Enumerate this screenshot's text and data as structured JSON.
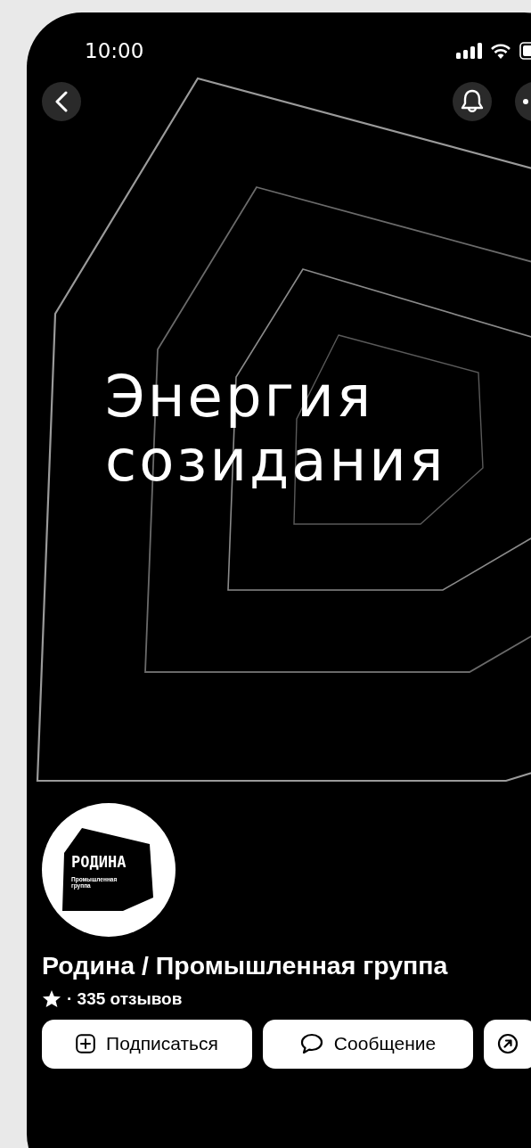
{
  "status_bar": {
    "time": "10:00"
  },
  "header": {
    "buttons": [
      {
        "kind": "back"
      },
      {
        "kind": "bell"
      },
      {
        "kind": "more"
      }
    ]
  },
  "cover": {
    "title": "Энергия созидания"
  },
  "profile": {
    "logo": {
      "wordmark": "РОДИНА",
      "subtitle": "Промышленная группа"
    },
    "name": "Родина / Промышленная группа",
    "reviews": "· 335 отзывов"
  },
  "actions": [
    {
      "kind": "subscribe",
      "label": "Подписаться"
    },
    {
      "kind": "message",
      "label": "Сообщение"
    },
    {
      "kind": "share"
    }
  ]
}
